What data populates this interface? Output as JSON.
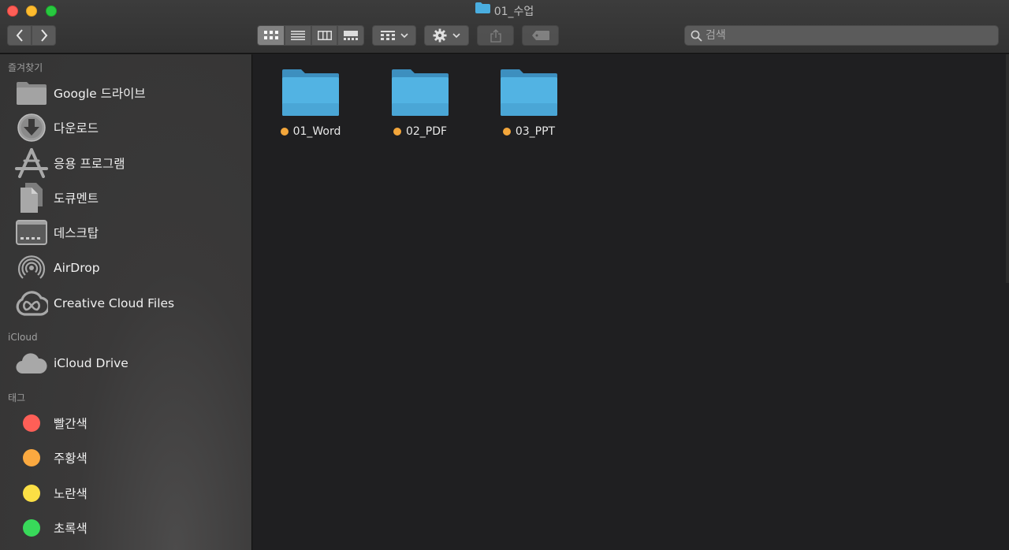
{
  "window": {
    "title": "01_수업"
  },
  "toolbar": {
    "search_placeholder": "검색"
  },
  "sidebar": {
    "favorites_heading": "즐겨찾기",
    "favorites": [
      {
        "label": "Google 드라이브",
        "icon": "folder-icon"
      },
      {
        "label": "다운로드",
        "icon": "download-icon"
      },
      {
        "label": "응용 프로그램",
        "icon": "applications-icon"
      },
      {
        "label": "도큐멘트",
        "icon": "documents-icon"
      },
      {
        "label": "데스크탑",
        "icon": "desktop-icon"
      },
      {
        "label": "AirDrop",
        "icon": "airdrop-icon"
      },
      {
        "label": "Creative Cloud Files",
        "icon": "creative-cloud-icon"
      }
    ],
    "icloud_heading": "iCloud",
    "icloud": [
      {
        "label": "iCloud Drive",
        "icon": "cloud-icon"
      }
    ],
    "tags_heading": "태그",
    "tags": [
      {
        "label": "빨간색",
        "color": "#fe5f57"
      },
      {
        "label": "주황색",
        "color": "#fba940"
      },
      {
        "label": "노란색",
        "color": "#fbdf45"
      },
      {
        "label": "초록색",
        "color": "#38d95a"
      }
    ]
  },
  "files": [
    {
      "name": "01_Word",
      "tag_color": "#f3a63b"
    },
    {
      "name": "02_PDF",
      "tag_color": "#f3a63b"
    },
    {
      "name": "03_PPT",
      "tag_color": "#f3a63b"
    }
  ],
  "colors": {
    "folder_blue": "#4aaee0",
    "sidebar_bg": "#3a3939",
    "content_bg": "#1f1f21"
  }
}
